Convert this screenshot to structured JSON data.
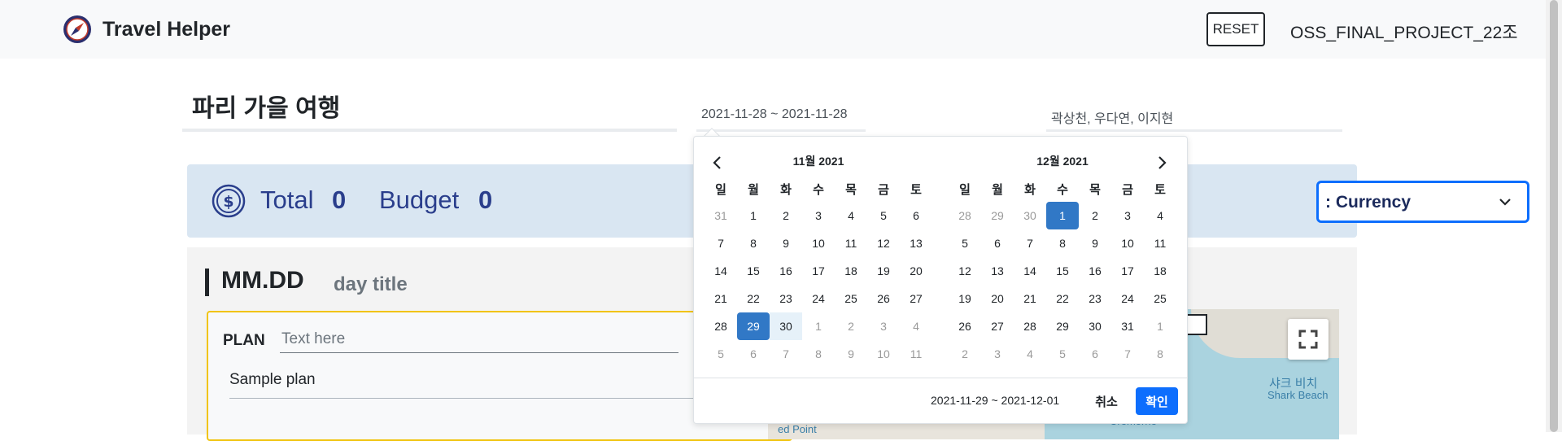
{
  "navbar": {
    "brand_title": "Travel Helper",
    "reset_label": "RESET",
    "project_name": "OSS_FINAL_PROJECT_22조"
  },
  "trip": {
    "title": "파리 가을 여행",
    "date_range": "2021-11-28 ~ 2021-11-28",
    "members": "곽상천, 우다연, 이지현"
  },
  "summary": {
    "total_label": "Total",
    "total_value": "0",
    "budget_label": "Budget",
    "budget_value": "0",
    "currency_text": ": Currency"
  },
  "day": {
    "date": "MM.DD",
    "title": "day title",
    "plan_label": "PLAN",
    "plan_placeholder": "Text here",
    "sample_plan": "Sample plan"
  },
  "map": {
    "label_ko": "샤크 비치",
    "label_en": "Shark Beach",
    "label_cremorne": "Cremorne",
    "label_seapoint": "ed Point"
  },
  "datepicker": {
    "months": [
      {
        "title": "11월 2021",
        "weekdays": [
          "일",
          "월",
          "화",
          "수",
          "목",
          "금",
          "토"
        ],
        "weeks": [
          [
            "31",
            "1",
            "2",
            "3",
            "4",
            "5",
            "6"
          ],
          [
            "7",
            "8",
            "9",
            "10",
            "11",
            "12",
            "13"
          ],
          [
            "14",
            "15",
            "16",
            "17",
            "18",
            "19",
            "20"
          ],
          [
            "21",
            "22",
            "23",
            "24",
            "25",
            "26",
            "27"
          ],
          [
            "28",
            "29",
            "30",
            "1",
            "2",
            "3",
            "4"
          ],
          [
            "5",
            "6",
            "7",
            "8",
            "9",
            "10",
            "11"
          ]
        ]
      },
      {
        "title": "12월 2021",
        "weekdays": [
          "일",
          "월",
          "화",
          "수",
          "목",
          "금",
          "토"
        ],
        "weeks": [
          [
            "28",
            "29",
            "30",
            "1",
            "2",
            "3",
            "4"
          ],
          [
            "5",
            "6",
            "7",
            "8",
            "9",
            "10",
            "11"
          ],
          [
            "12",
            "13",
            "14",
            "15",
            "16",
            "17",
            "18"
          ],
          [
            "19",
            "20",
            "21",
            "22",
            "23",
            "24",
            "25"
          ],
          [
            "26",
            "27",
            "28",
            "29",
            "30",
            "31",
            "1"
          ],
          [
            "2",
            "3",
            "4",
            "5",
            "6",
            "7",
            "8"
          ]
        ]
      }
    ],
    "selected_range": "2021-11-29 ~ 2021-12-01",
    "cancel_label": "취소",
    "ok_label": "확인"
  },
  "colors": {
    "accent": "#0d6efd",
    "selected_day": "#3178c6",
    "summary_bg": "#d9e6f2",
    "plan_border": "#f1c40f"
  }
}
